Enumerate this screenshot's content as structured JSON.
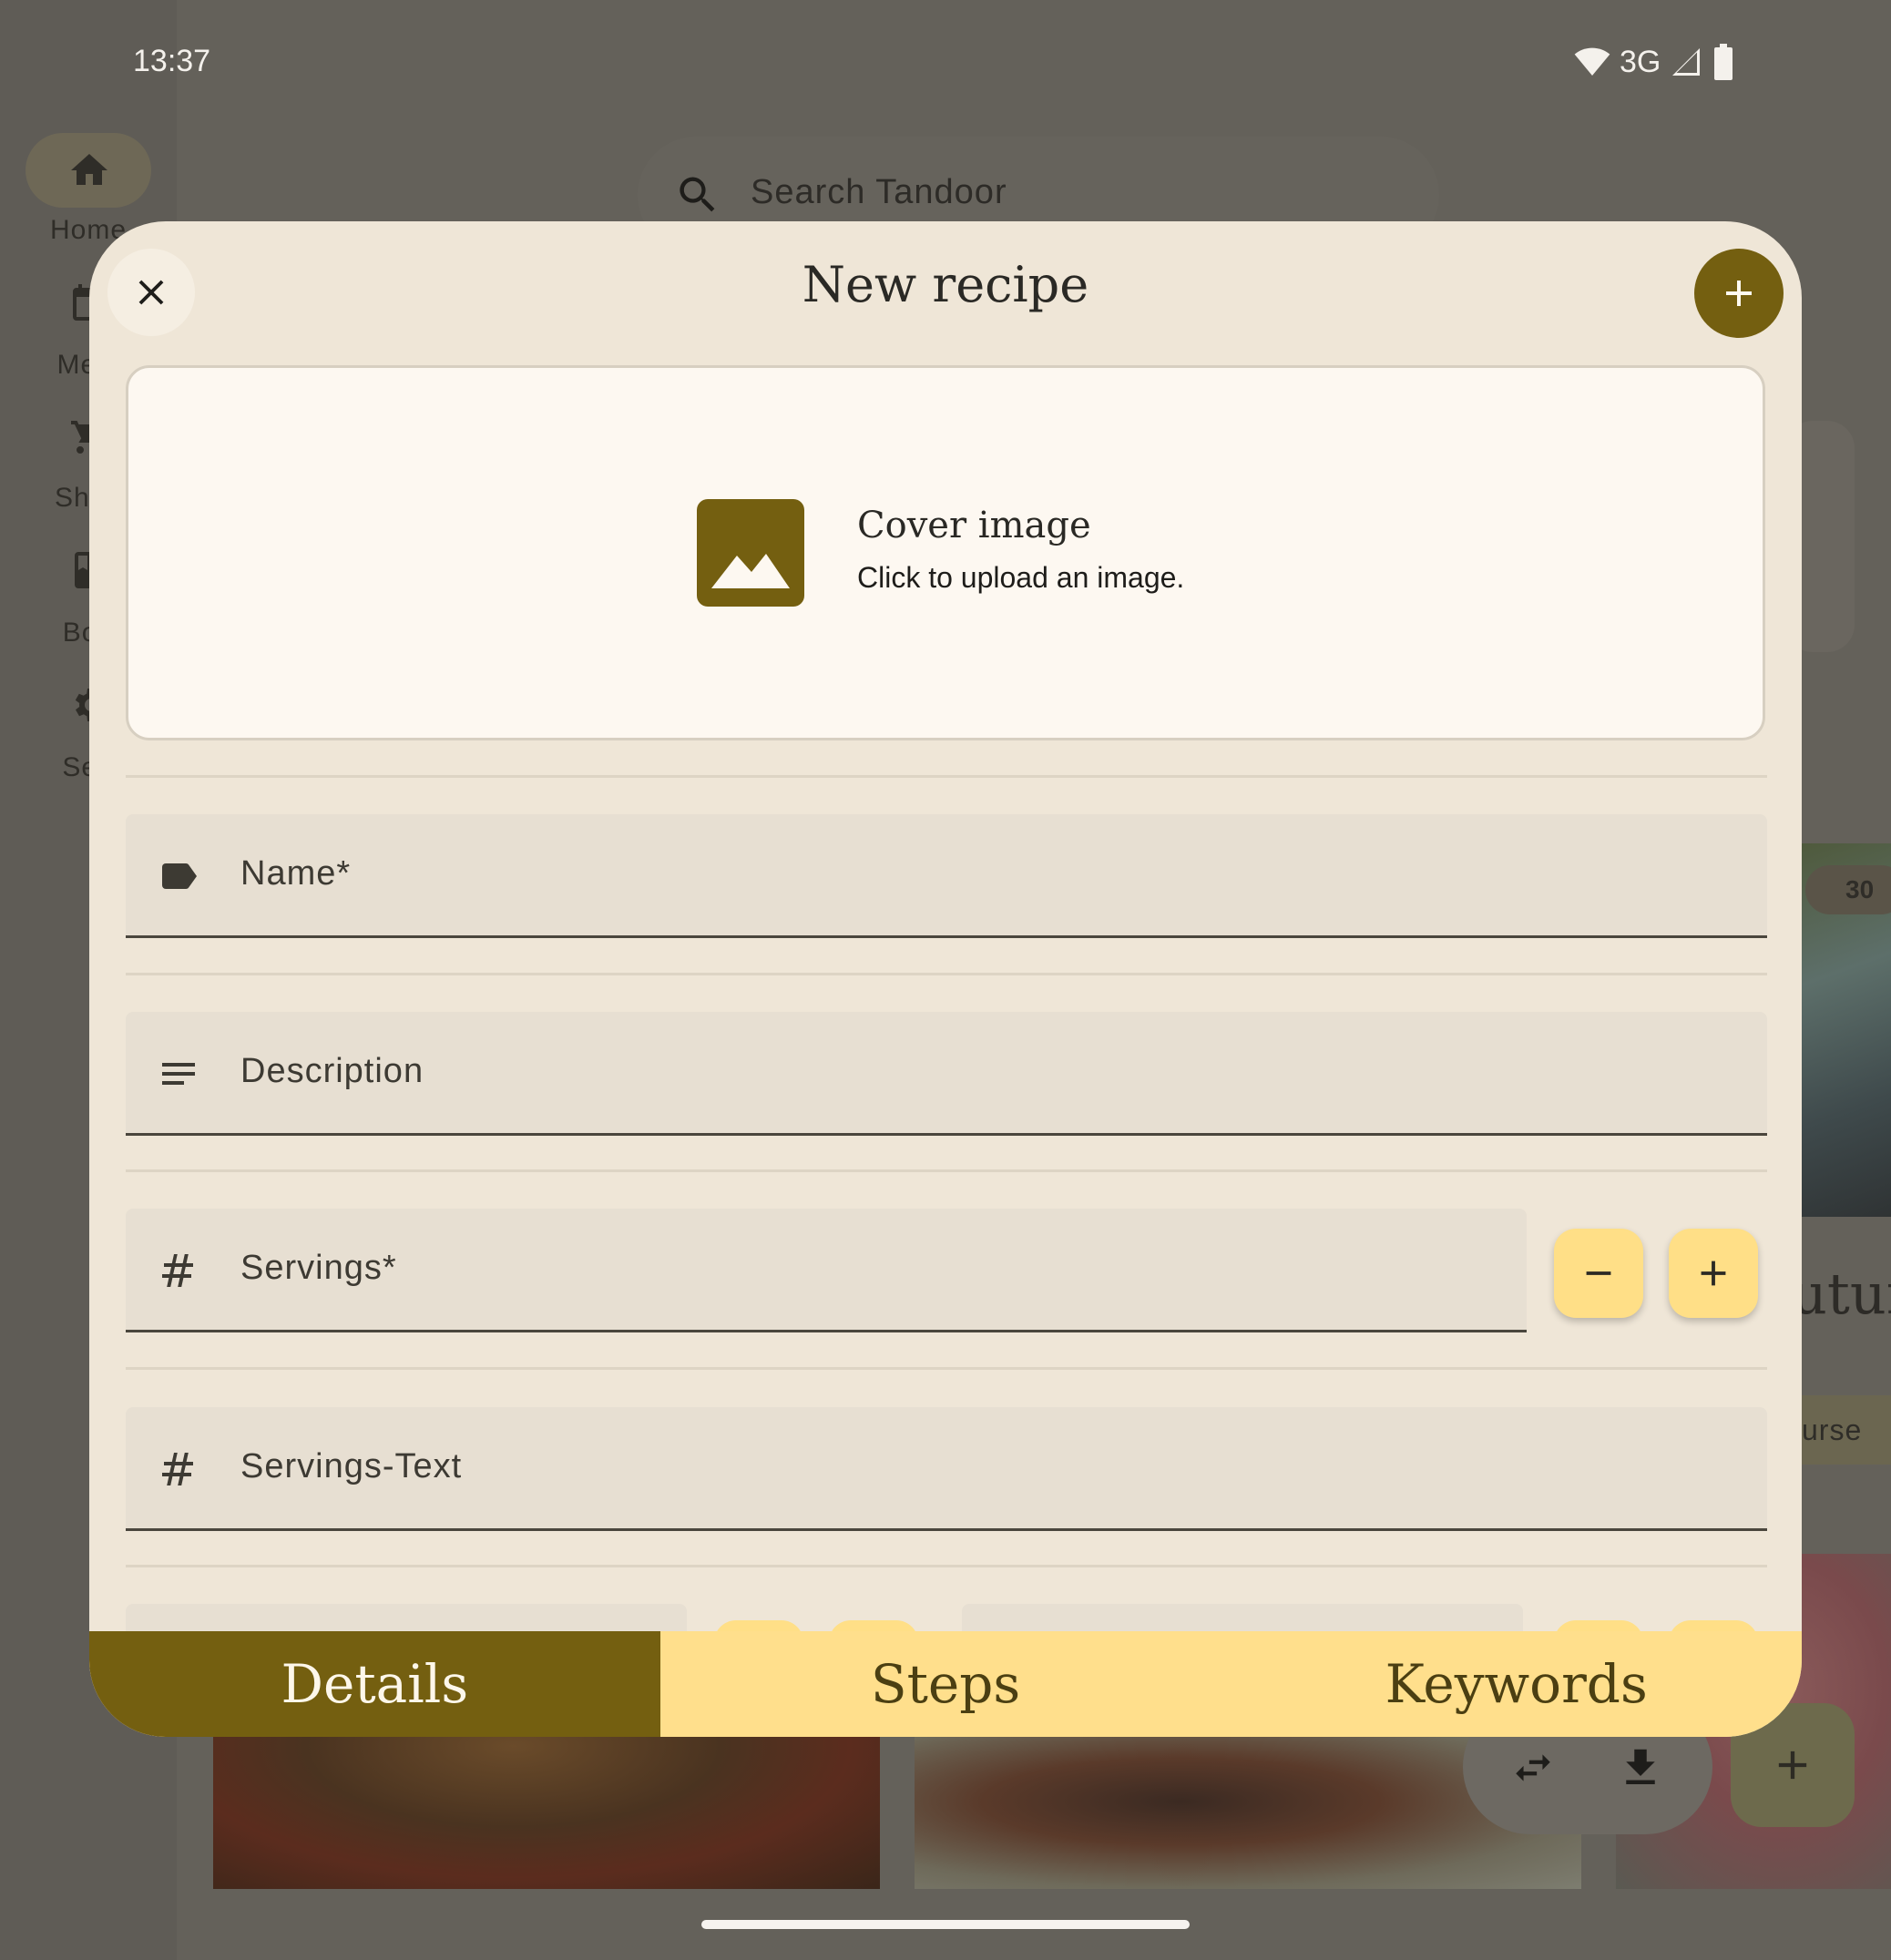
{
  "status_bar": {
    "time": "13:37",
    "network": "3G"
  },
  "background": {
    "nav_rail": [
      {
        "label": "Home",
        "icon": "home-icon"
      },
      {
        "label": "Meal",
        "icon": "calendar-icon"
      },
      {
        "label": "Shop",
        "icon": "cart-icon"
      },
      {
        "label": "Boo",
        "icon": "book-icon"
      },
      {
        "label": "Sett",
        "icon": "gear-icon"
      }
    ],
    "search_placeholder": "Search Tandoor",
    "timer_badge": "30",
    "title_fragment": "utur",
    "chip_fragment": "urse"
  },
  "dialog": {
    "title": "New recipe",
    "cover": {
      "title": "Cover image",
      "subtitle": "Click to upload an image."
    },
    "fields": {
      "name": "Name*",
      "description": "Description",
      "servings": "Servings*",
      "servings_text": "Servings-Text"
    },
    "tabs": [
      {
        "label": "Details",
        "active": true
      },
      {
        "label": "Steps",
        "active": false
      },
      {
        "label": "Keywords",
        "active": false
      }
    ]
  },
  "colors": {
    "primary": "#745f10",
    "tab_bar": "#ffdf8c",
    "dialog_surface": "#efe6d7",
    "field_fill": "#e7dfd2",
    "stepper": "#ffdf87"
  }
}
